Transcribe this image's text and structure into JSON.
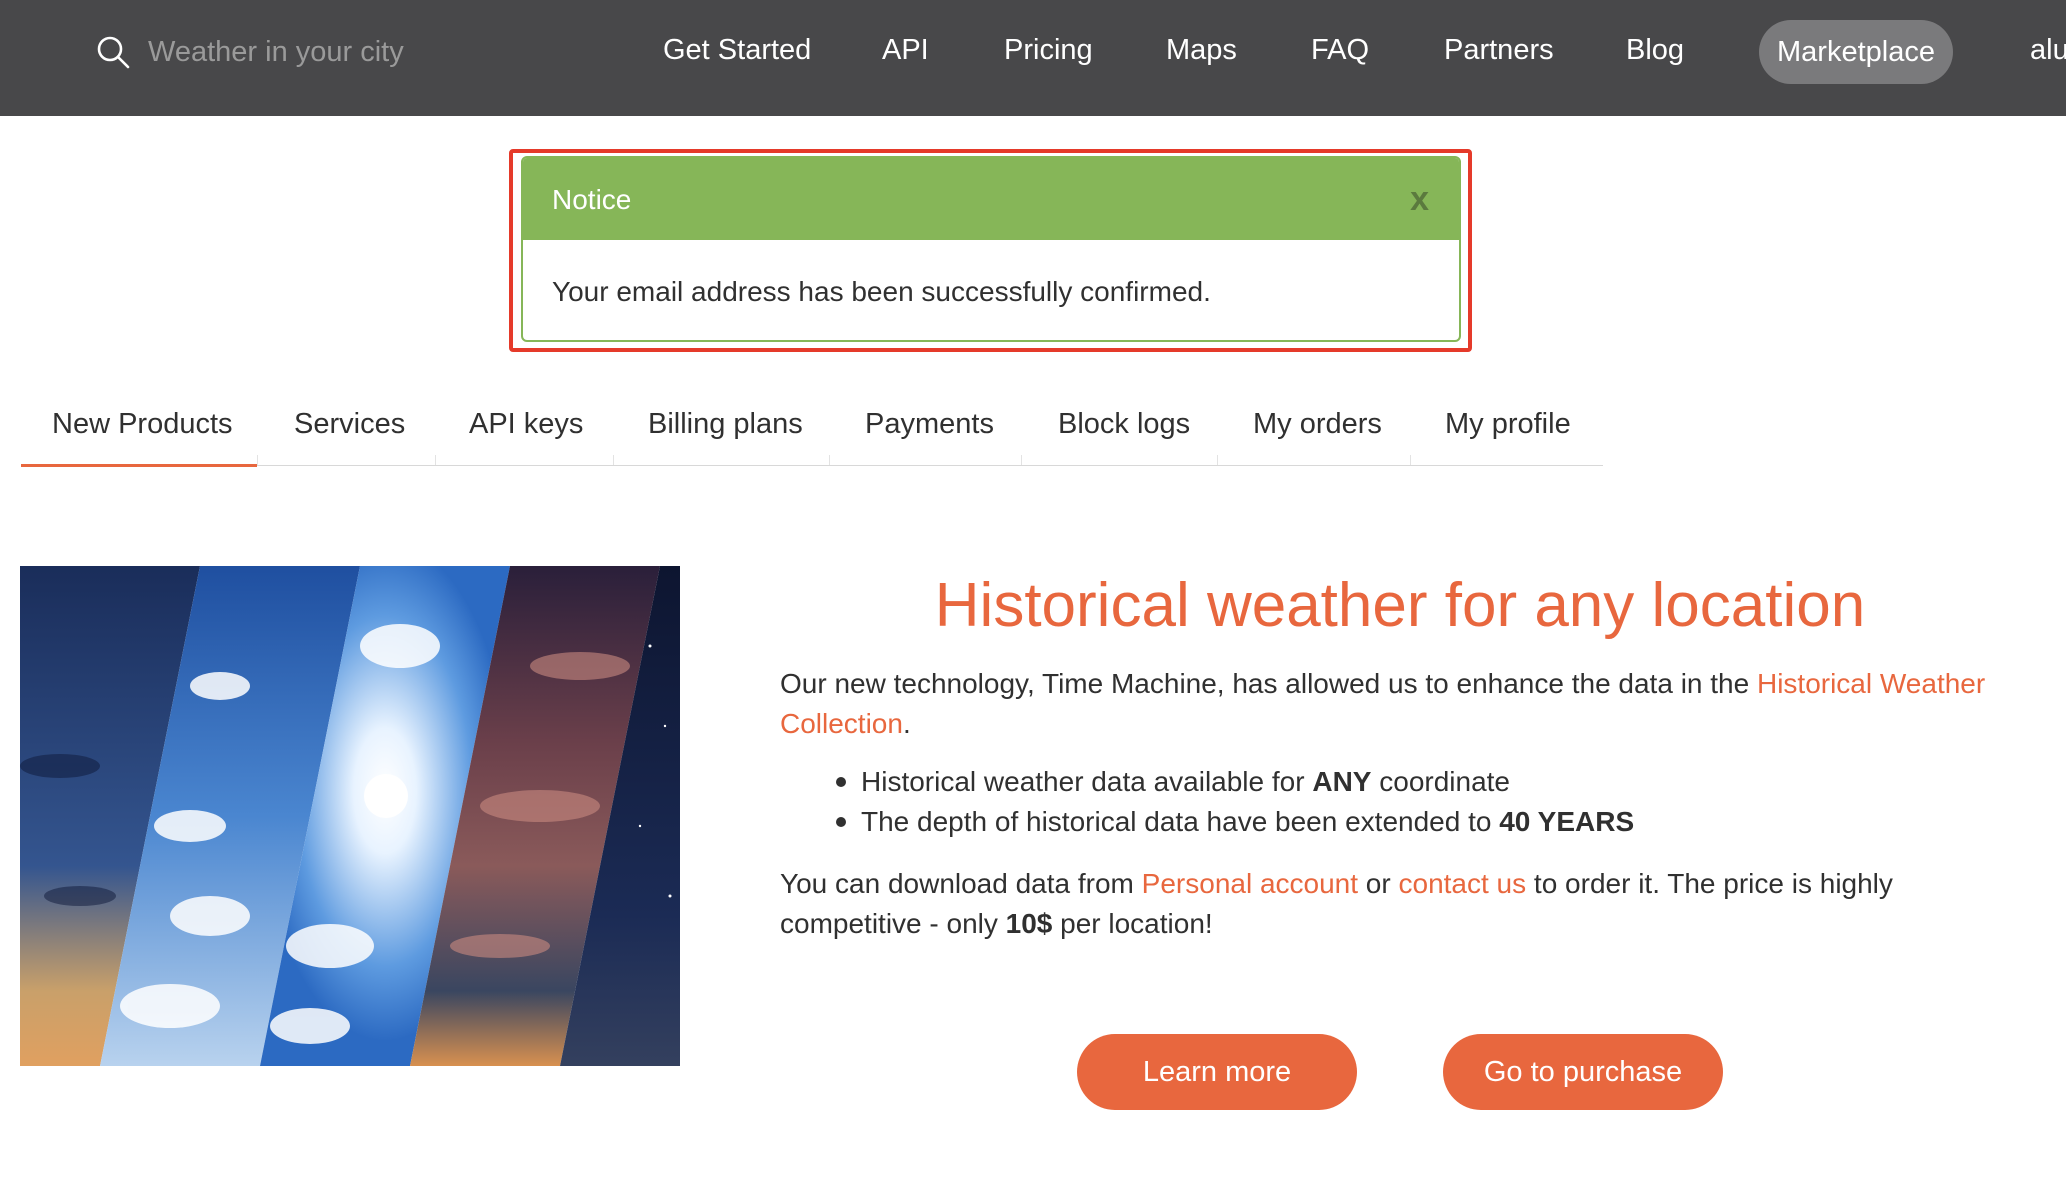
{
  "nav": {
    "search_placeholder": "Weather in your city",
    "items": [
      "Get Started",
      "API",
      "Pricing",
      "Maps",
      "FAQ",
      "Partners",
      "Blog"
    ],
    "marketplace": "Marketplace",
    "user_partial": "alu"
  },
  "notice": {
    "title": "Notice",
    "close": "x",
    "message": "Your email address has been successfully confirmed."
  },
  "tabs": [
    "New Products",
    "Services",
    "API keys",
    "Billing plans",
    "Payments",
    "Block logs",
    "My orders",
    "My profile"
  ],
  "product": {
    "headline": "Historical weather for any location",
    "intro_text": "Our new technology, Time Machine, has allowed us to enhance the data in the ",
    "intro_link": "Historical Weather Collection",
    "intro_end": ".",
    "bullet1_pre": "Historical weather data available for ",
    "bullet1_bold": "ANY",
    "bullet1_post": " coordinate",
    "bullet2_pre": "The depth of historical data have been extended to ",
    "bullet2_bold": "40 YEARS",
    "download_pre": "You can download data from ",
    "download_link1": "Personal account",
    "download_mid": " or ",
    "download_link2": "contact us",
    "download_post": " to order it. The price is highly competitive - only ",
    "download_price": "10$",
    "download_end": " per location!",
    "learn_more": "Learn more",
    "purchase": "Go to purchase"
  },
  "colors": {
    "nav_bg": "#48484a",
    "accent": "#e8673e",
    "notice_green": "#86b658",
    "highlight_red": "#e53a2a"
  }
}
